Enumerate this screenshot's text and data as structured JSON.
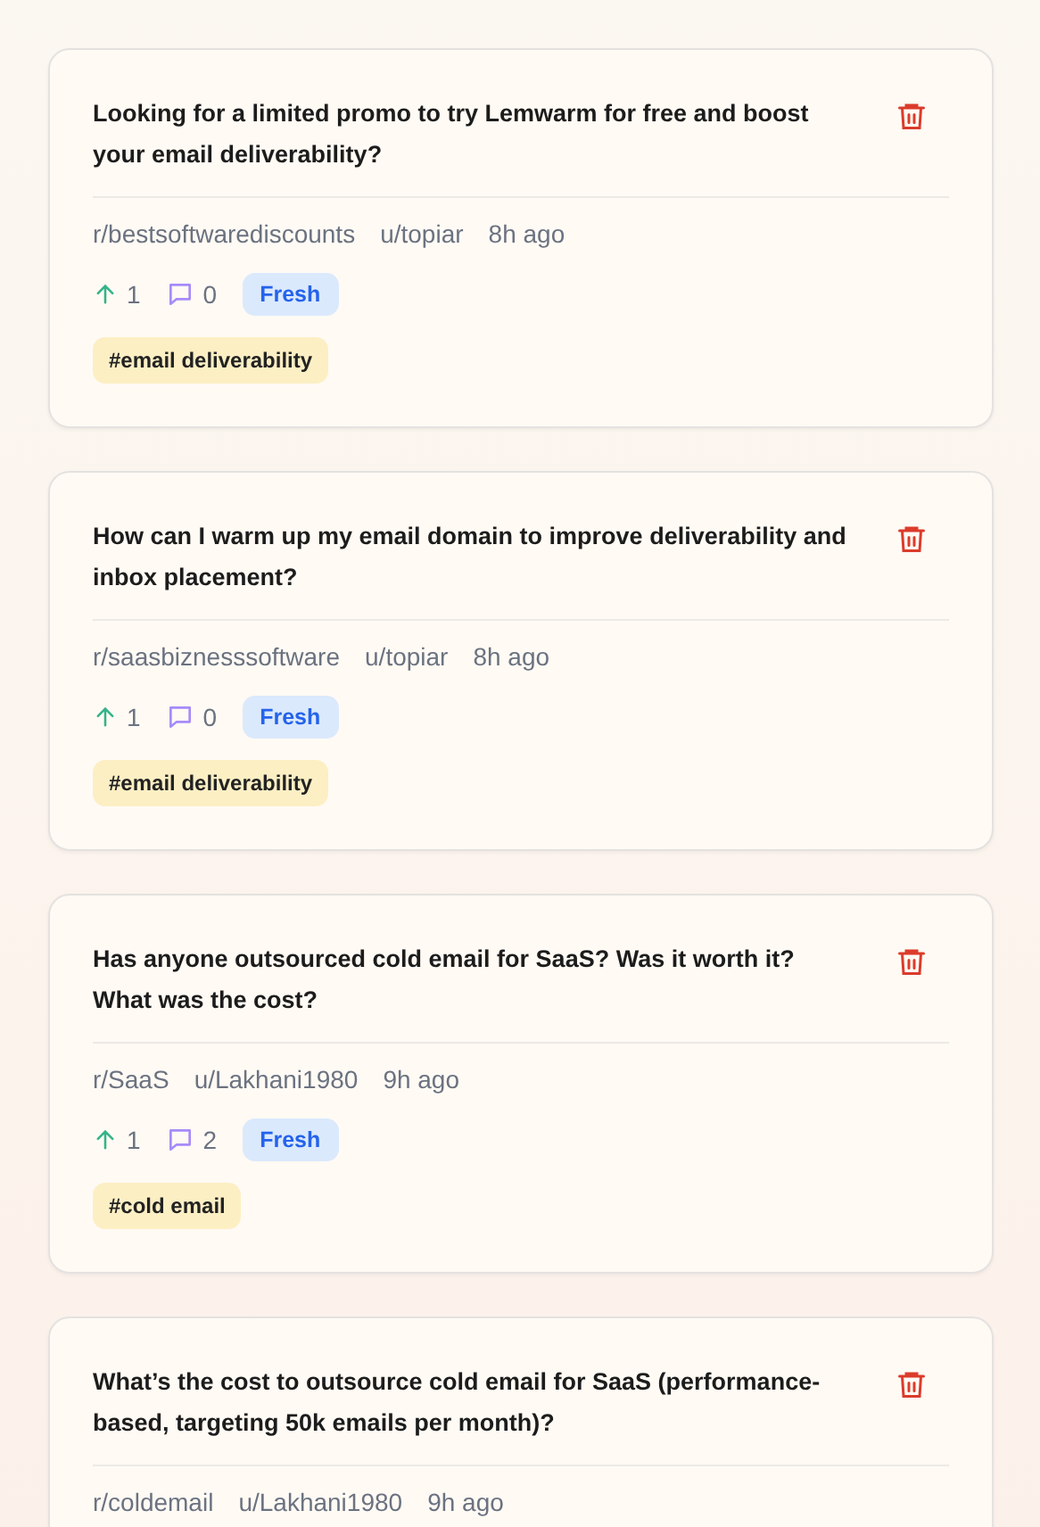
{
  "posts": [
    {
      "title": "Looking for a limited promo to try Lemwarm for free and boost your email deliverability?",
      "subreddit": "r/bestsoftwarediscounts",
      "author": "u/topiar",
      "time": "8h ago",
      "upvotes": "1",
      "comments": "0",
      "status": "Fresh",
      "tags": [
        "#email deliverability"
      ]
    },
    {
      "title": "How can I warm up my email domain to improve deliverability and inbox placement?",
      "subreddit": "r/saasbiznesssoftware",
      "author": "u/topiar",
      "time": "8h ago",
      "upvotes": "1",
      "comments": "0",
      "status": "Fresh",
      "tags": [
        "#email deliverability"
      ]
    },
    {
      "title": "Has anyone outsourced cold email for SaaS? Was it worth it? What was the cost?",
      "subreddit": "r/SaaS",
      "author": "u/Lakhani1980",
      "time": "9h ago",
      "upvotes": "1",
      "comments": "2",
      "status": "Fresh",
      "tags": [
        "#cold email"
      ]
    },
    {
      "title": "What’s the cost to outsource cold email for SaaS (performance-based, targeting 50k emails per month)?",
      "subreddit": "r/coldemail",
      "author": "u/Lakhani1980",
      "time": "9h ago"
    }
  ]
}
